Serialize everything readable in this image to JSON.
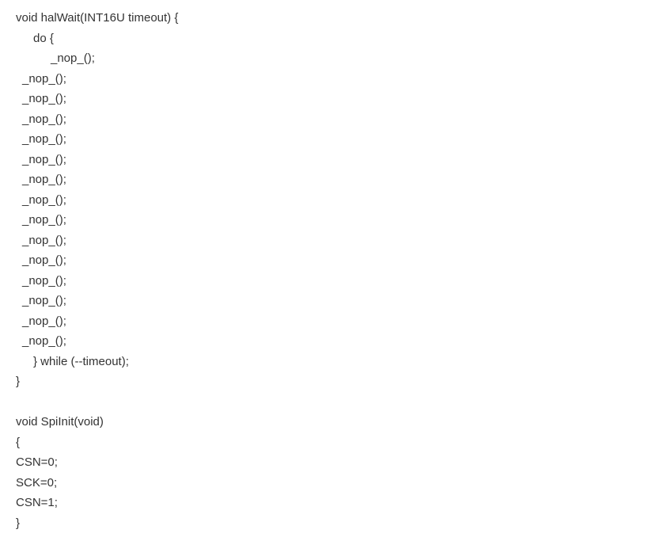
{
  "code": {
    "lines": [
      {
        "text": "void halWait(INT16U timeout) {",
        "indent": "indent-0"
      },
      {
        "text": "do {",
        "indent": "indent-1"
      },
      {
        "text": "_nop_();",
        "indent": "indent-2"
      },
      {
        "text": "_nop_();",
        "indent": "indent-small"
      },
      {
        "text": "_nop_();",
        "indent": "indent-small"
      },
      {
        "text": "_nop_();",
        "indent": "indent-small"
      },
      {
        "text": "_nop_();",
        "indent": "indent-small"
      },
      {
        "text": "_nop_();",
        "indent": "indent-small"
      },
      {
        "text": "_nop_();",
        "indent": "indent-small"
      },
      {
        "text": "_nop_();",
        "indent": "indent-small"
      },
      {
        "text": "_nop_();",
        "indent": "indent-small"
      },
      {
        "text": "_nop_();",
        "indent": "indent-small"
      },
      {
        "text": "_nop_();",
        "indent": "indent-small"
      },
      {
        "text": "_nop_();",
        "indent": "indent-small"
      },
      {
        "text": "_nop_();",
        "indent": "indent-small"
      },
      {
        "text": "_nop_();",
        "indent": "indent-small"
      },
      {
        "text": "_nop_();",
        "indent": "indent-small"
      },
      {
        "text": "} while (--timeout);",
        "indent": "indent-1"
      },
      {
        "text": "}",
        "indent": "indent-0"
      },
      {
        "text": "",
        "indent": "indent-0"
      },
      {
        "text": "void SpiInit(void)",
        "indent": "indent-0"
      },
      {
        "text": "{",
        "indent": "indent-0"
      },
      {
        "text": "CSN=0;",
        "indent": "indent-0"
      },
      {
        "text": "SCK=0;",
        "indent": "indent-0"
      },
      {
        "text": "CSN=1;",
        "indent": "indent-0"
      },
      {
        "text": "}",
        "indent": "indent-0"
      }
    ]
  }
}
